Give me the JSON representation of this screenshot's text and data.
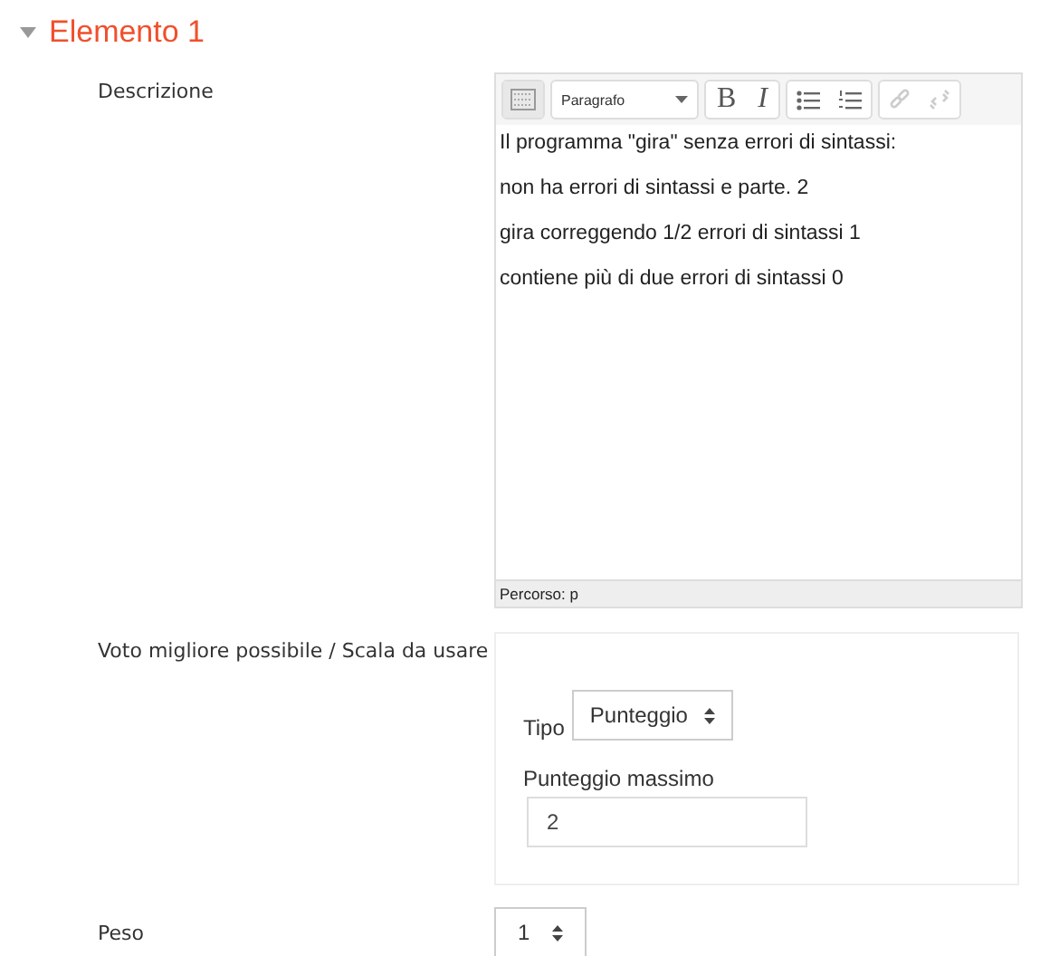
{
  "section": {
    "title": "Elemento 1",
    "expanded": true
  },
  "description": {
    "label": "Descrizione",
    "toolbar": {
      "format": "Paragrafo",
      "bold": "B",
      "italic": "I"
    },
    "paragraphs": [
      "Il programma \"gira\" senza errori di sintassi:",
      "non ha errori di sintassi e parte. 2",
      "gira correggendo 1/2 errori di sintassi 1",
      "contiene più di due errori di sintassi 0"
    ],
    "path": "Percorso: p"
  },
  "grade": {
    "label": "Voto migliore possibile / Scala da usare",
    "type_label": "Tipo",
    "type_value": "Punteggio",
    "max_label": "Punteggio massimo",
    "max_value": "2"
  },
  "weight": {
    "label": "Peso",
    "value": "1"
  }
}
